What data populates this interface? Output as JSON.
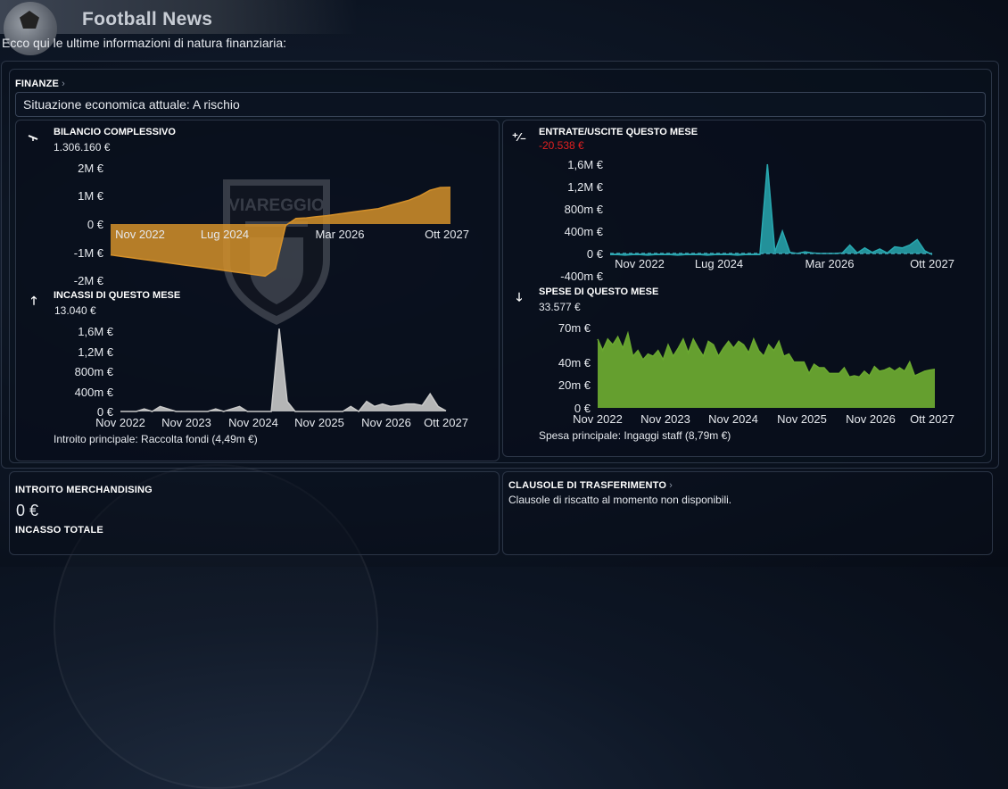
{
  "header": {
    "title": "Football News"
  },
  "intro": "Ecco qui le ultime informazioni di natura finanziaria:",
  "finance": {
    "section_title": "FINANZE",
    "status": "Situazione economica attuale: A rischio",
    "watermark_text": "VIAREGGIO"
  },
  "charts": {
    "balance": {
      "title": "BILANCIO COMPLESSIVO",
      "value": "1.306.160 €"
    },
    "net": {
      "title": "ENTRATE/USCITE QUESTO MESE",
      "value": "-20.538 €"
    },
    "income": {
      "title": "INCASSI DI QUESTO MESE",
      "value": "13.040 €",
      "note": "Introito principale:  Raccolta fondi (4,49m €)"
    },
    "expenses": {
      "title": "SPESE DI QUESTO MESE",
      "value": "33.577 €",
      "note": "Spesa principale:  Ingaggi staff (8,79m €)"
    }
  },
  "merch": {
    "title": "INTROITO MERCHANDISING",
    "value": "0 €",
    "total_label": "INCASSO TOTALE"
  },
  "transfer": {
    "title": "CLAUSOLE DI TRASFERIMENTO",
    "text": "Clausole di riscatto al momento non disponibili."
  },
  "colors": {
    "balance": "#d4902a",
    "net": "#28a8b0",
    "income": "#c8c8c8",
    "expenses": "#6aa830",
    "negative": "#e02020"
  },
  "chart_data": [
    {
      "type": "area",
      "title": "BILANCIO COMPLESSIVO",
      "x_tick_labels": [
        "Nov 2022",
        "Lug 2024",
        "Mar 2026",
        "Ott 2027"
      ],
      "y_tick_labels": [
        "2M €",
        "1M €",
        "0 €",
        "-1M €",
        "-2M €"
      ],
      "ylim": [
        -2000000,
        2000000
      ],
      "values": [
        -1100000,
        -1150000,
        -1200000,
        -1250000,
        -1300000,
        -1350000,
        -1400000,
        -1450000,
        -1500000,
        -1550000,
        -1600000,
        -1650000,
        -1700000,
        -1750000,
        -1800000,
        -1850000,
        -1600000,
        -50000,
        200000,
        220000,
        260000,
        300000,
        350000,
        400000,
        450000,
        500000,
        550000,
        650000,
        750000,
        850000,
        1000000,
        1200000,
        1300000,
        1306160
      ]
    },
    {
      "type": "area",
      "title": "ENTRATE/USCITE QUESTO MESE",
      "x_tick_labels": [
        "Nov 2022",
        "Lug 2024",
        "Mar 2026",
        "Ott 2027"
      ],
      "y_tick_labels": [
        "1,6M €",
        "1,2M €",
        "800m €",
        "400m €",
        "0 €",
        "-400m €"
      ],
      "ylim": [
        -400000,
        1600000
      ],
      "values": [
        -20000,
        -20000,
        -30000,
        -20000,
        -20000,
        -30000,
        -20000,
        -20000,
        -20000,
        -30000,
        -20000,
        -20000,
        -20000,
        -30000,
        -20000,
        -20000,
        -20000,
        -30000,
        -20000,
        -20000,
        -20000,
        1600000,
        30000,
        400000,
        20000,
        0,
        30000,
        10000,
        0,
        0,
        0,
        10000,
        150000,
        10000,
        100000,
        20000,
        80000,
        10000,
        120000,
        100000,
        150000,
        250000,
        50000,
        -20538
      ]
    },
    {
      "type": "area",
      "title": "INCASSI DI QUESTO MESE",
      "x_tick_labels": [
        "Nov 2022",
        "Nov 2023",
        "Nov 2024",
        "Nov 2025",
        "Nov 2026",
        "Ott 2027"
      ],
      "y_tick_labels": [
        "1,6M €",
        "1,2M €",
        "800m €",
        "400m €",
        "0 €"
      ],
      "ylim": [
        0,
        1600000
      ],
      "values": [
        0,
        0,
        0,
        50000,
        0,
        100000,
        50000,
        0,
        0,
        0,
        0,
        0,
        50000,
        0,
        50000,
        100000,
        0,
        0,
        0,
        0,
        1650000,
        200000,
        0,
        0,
        0,
        0,
        0,
        0,
        0,
        100000,
        0,
        200000,
        100000,
        150000,
        100000,
        120000,
        150000,
        150000,
        120000,
        350000,
        100000,
        13040
      ]
    },
    {
      "type": "area",
      "title": "SPESE DI QUESTO MESE",
      "x_tick_labels": [
        "Nov 2022",
        "Nov 2023",
        "Nov 2024",
        "Nov 2025",
        "Nov 2026",
        "Ott 2027"
      ],
      "y_tick_labels": [
        "70m €",
        "40m €",
        "20m €",
        "0 €"
      ],
      "ylim": [
        0,
        70
      ],
      "values": [
        60,
        50,
        60,
        55,
        62,
        52,
        65,
        45,
        50,
        42,
        47,
        45,
        50,
        42,
        55,
        45,
        52,
        60,
        48,
        60,
        52,
        45,
        58,
        55,
        45,
        52,
        58,
        52,
        58,
        55,
        48,
        60,
        50,
        45,
        55,
        50,
        58,
        45,
        47,
        40,
        40,
        40,
        30,
        38,
        35,
        35,
        30,
        30,
        30,
        35,
        27,
        28,
        27,
        32,
        28,
        36,
        32,
        33,
        35,
        32,
        35,
        32,
        40,
        28,
        30,
        32,
        33,
        33.6
      ]
    }
  ]
}
